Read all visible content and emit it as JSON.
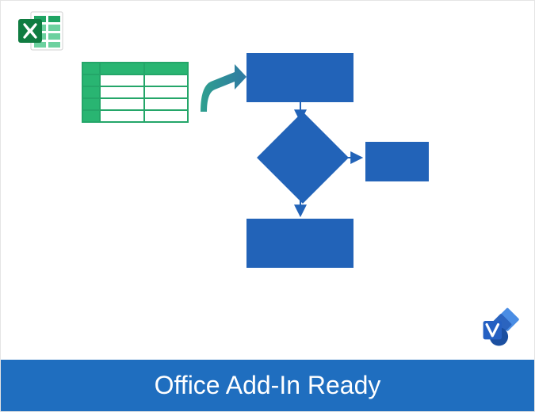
{
  "diagram": {
    "type": "illustration",
    "icons": {
      "top_left": "excel-icon",
      "bottom_right": "visio-icon"
    },
    "flow": {
      "source": "excel-table",
      "shapes": [
        "process-top",
        "decision-diamond",
        "process-bottom",
        "process-right"
      ]
    }
  },
  "banner": {
    "text": "Office Add-In Ready",
    "background": "#1f6ebf",
    "text_color": "#ffffff"
  },
  "colors": {
    "flow_blue": "#2263b8",
    "excel_green": "#29b572",
    "arrow_teal": "#328f8a"
  }
}
